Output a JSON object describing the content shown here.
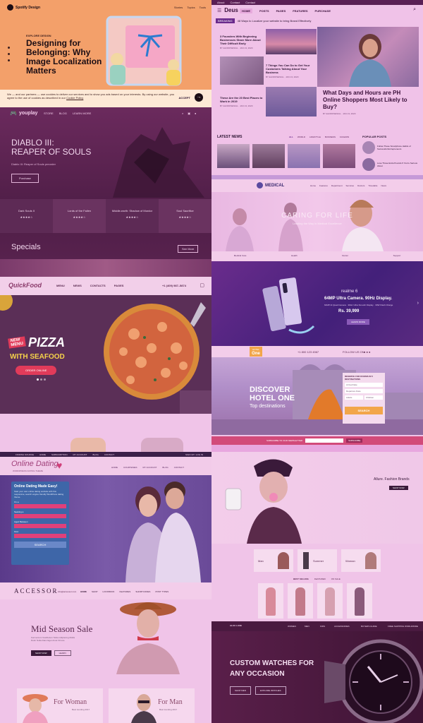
{
  "spotify": {
    "logo": "Spotify Design",
    "nav": [
      "Stories",
      "Topics",
      "Tools"
    ],
    "tag": "EXPLORE DESIGN",
    "title": "Designing for Belonging: Why Image Localization Matters",
    "cookie_text": "We — and our partners — use cookies to deliver our services and to show you ads based on your interests. By using our website, you agree to the use of cookies as described in our",
    "cookie_link": "Cookie Policy",
    "accept": "ACCEPT"
  },
  "deus": {
    "top_links": [
      "About",
      "Contact",
      "Contact"
    ],
    "logo": "Deus",
    "nav": [
      "HOME",
      "POSTS",
      "PAGES",
      "FEATURES",
      "PURCHASE"
    ],
    "ticker_label": "BREAKING",
    "ticker_text": "48 Ways to Localize your website to bring Brand Effectively",
    "posts": [
      {
        "title": "3 Founders With Beginning Businesses Share More About Their Difficult Early",
        "meta": "BY ELDROSESIAL · JAN 13, 2020"
      },
      {
        "title": "7 Things You Can Do to Get Your Customers Talking About Your Business",
        "meta": "BY ELDROSESIAL · JAN 13, 2020"
      },
      {
        "title": "These Are the 20 Best Places to Work in 2019",
        "meta": "BY ELDROSESIAL · JAN 13, 2020"
      }
    ],
    "feature_title": "What Days and Hours are PH Online Shoppers Most Likely to Buy?",
    "feature_meta": "BY ELDROSESIAL · JAN 13, 2020",
    "latest_news": "LATEST NEWS",
    "tabs": [
      "ALL",
      "WORLD",
      "LIFESTYLE",
      "BUSINESS",
      "FASHION"
    ],
    "popular": "POPULAR POSTS",
    "popular_items": [
      "Follow These Smartphone Habits of Successful Entrepreneurs",
      "Lose Those Extra Pounds If You're Serious About"
    ]
  },
  "youplay": {
    "logo": "youplay",
    "nav": [
      "STORE",
      "BLOG",
      "LEARN MORE"
    ],
    "title_line1": "DIABLO III:",
    "title_line2": "REAPER OF SOULS",
    "subtitle": "Diablo III: Reaper of Souls preorder",
    "button": "Purchase",
    "games": [
      "Dark Souls II",
      "Lords of the Fallen",
      "Middle-earth: Shadow of Mordor",
      "Soul Sacrifice"
    ],
    "stars": [
      4,
      4,
      4,
      4
    ],
    "specials": "Specials",
    "see_more": "See More"
  },
  "medical": {
    "logo": "MEDICAL",
    "nav": [
      "Home",
      "Features",
      "Department",
      "Services",
      "Doctors",
      "Timetable",
      "News"
    ],
    "hero": "CARING FOR LIFE",
    "hero_sub": "Leading the Way in Medical Excellence",
    "features": [
      "Medical Care",
      "Health",
      "Doctor",
      "Support"
    ]
  },
  "quickfood": {
    "logo": "QuickFood",
    "nav": [
      "MENU",
      "NEWS",
      "CONTACTS",
      "PAGES"
    ],
    "phone": "+1 (409) 987–5874",
    "badge_line1": "NEW",
    "badge_line2": "MENU",
    "title": "PIZZA",
    "subtitle": "WITH SEAFOOD",
    "button": "ORDER ONLINE"
  },
  "phone": {
    "brand": "realme 6",
    "title": "64MP Ultra Camera. 90Hz Display.",
    "specs": "64MP AI Quad Camera · 90Hz Ultra Smooth Display · 30W Flash Charge",
    "price": "Rs. 39,999",
    "button": "LEARN MORE"
  },
  "hotel": {
    "logo_top": "HOTEL",
    "logo_main": "One",
    "phone": "+1 800 123 4567",
    "follow": "FOLLOW US ON",
    "title_line1": "DISCOVER",
    "title_line2": "HOTEL ONE",
    "subtitle": "Top destinations",
    "form_title": "RESERVE FOR ROOMS IN 5 DESTINATIONS",
    "form_fields": [
      "Arrival Date",
      "Departure Date",
      "Adults",
      "Children"
    ],
    "search": "SEARCH",
    "newsletter": "SUBSCRIBE TO OUR NEWSLETTER",
    "subscribe": "SUBSCRIBE"
  },
  "dating": {
    "top_bar": [
      "FINDING SOURCE",
      "HOME",
      "SUBSCRIPTION",
      "MY ACCOUNT",
      "BLOG",
      "CONTACT"
    ],
    "top_right": "SIGN UP / LOG IN",
    "logo": "Online Dating",
    "logo_sub": "WORDPRESS DATING THEME",
    "nav": [
      "HOME",
      "COURTESIES",
      "MY ACCOUNT",
      "BLOG",
      "CONTACT"
    ],
    "form_title": "Online Dating Made Easy!",
    "form_text": "Start your own online dating website with this responsive, search engine friendly WordPress dating theme.",
    "fields": [
      "I'm a",
      "Seeking a",
      "Aged Between",
      "Find"
    ],
    "search": "SEARCH"
  },
  "fashion": {
    "brand": "Allure. Fashion Brands",
    "button": "SHOP NOW",
    "promos": [
      "Man",
      "Summer",
      "Woman"
    ],
    "tabs": [
      "BEST SELLING",
      "FEATURED",
      "ON SALE"
    ]
  },
  "accessor": {
    "logo": "ACCESSOR",
    "email": "info@accessor.com",
    "nav": [
      "HOME",
      "SHOP",
      "LOOKBOOK",
      "FEATURES",
      "SHORTCODES",
      "POST TYPES"
    ],
    "title": "Mid Season Sale",
    "text": "Fermentum Vestibulum Tellus Adipiscing Mollis Dolor Nulla Diam Eget Amet Ornare",
    "button1": "SHOP NOW",
    "button2": "LEARN",
    "cards": [
      {
        "title": "For Woman",
        "sub": "Best trending 2017"
      },
      {
        "title": "For Man",
        "sub": "Best trending 2017"
      }
    ]
  },
  "watches": {
    "logo": "ALUX LUXE",
    "nav": [
      "WOMEN",
      "MEN",
      "KIDS",
      "ACCESSORIES",
      "BUYERS GUIDE"
    ],
    "right": "FREE SHIPPING WORLDWIDE",
    "title_line1": "CUSTOM WATCHES FOR",
    "title_line2": "ANY OCCASION",
    "button1": "SHOP MEN",
    "button2": "EXPLORE WATCHES"
  }
}
